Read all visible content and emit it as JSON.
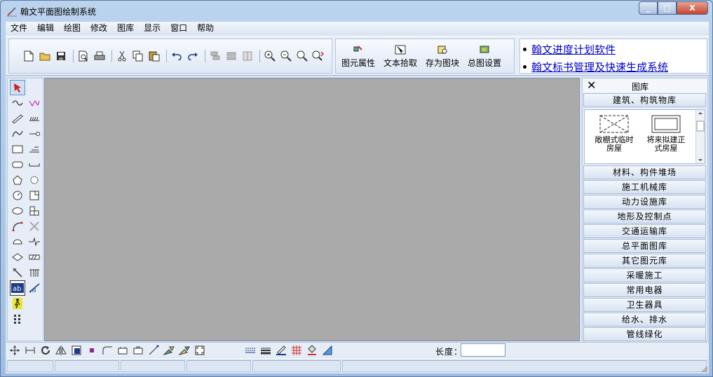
{
  "window": {
    "title": "翰文平面图绘制系统",
    "minimize": "_",
    "maximize": "□",
    "close": "X"
  },
  "menu": [
    "文件",
    "编辑",
    "绘图",
    "修改",
    "图库",
    "显示",
    "窗口",
    "帮助"
  ],
  "toolbar2": [
    {
      "label": "图元属性",
      "icon": "properties-icon"
    },
    {
      "label": "文本拾取",
      "icon": "text-pick-icon"
    },
    {
      "label": "存为图块",
      "icon": "save-block-icon"
    },
    {
      "label": "总图设置",
      "icon": "site-settings-icon"
    }
  ],
  "links": [
    "翰文进度计划软件",
    "翰文标书管理及快速生成系统"
  ],
  "library": {
    "title": "图库",
    "close": "✕",
    "top_category": "建筑、构筑物库",
    "preview_items": [
      "敞棚式临时房屋",
      "将来拟建正式房屋"
    ],
    "categories": [
      "材料、构件堆场",
      "施工机械库",
      "动力设施库",
      "地形及控制点",
      "交通运输库",
      "总平面图库",
      "其它图元库",
      "采暖施工",
      "常用电器",
      "卫生器具",
      "给水、排水",
      "管线绿化"
    ]
  },
  "length": {
    "label": "长度：",
    "value": ""
  },
  "colors": {
    "link": "#0000cc",
    "canvas": "#aaaaaa",
    "close_button": "#c6452c"
  }
}
